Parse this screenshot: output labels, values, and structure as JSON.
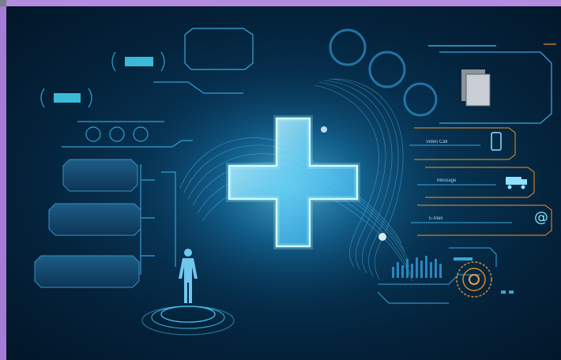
{
  "hud": {
    "contact_items": [
      {
        "label": "Video Call",
        "icon": "phone-icon"
      },
      {
        "label": "Message",
        "icon": "message-truck-icon"
      },
      {
        "label": "E-Mail",
        "icon": "at-sign-icon"
      }
    ]
  },
  "colors": {
    "background_dark": "#021628",
    "background_mid": "#0c4b73",
    "glow_cyan": "#6fe3ff",
    "hud_line": "#2f9fd6",
    "accent_orange": "#d9882a",
    "frame_purple": "#a57bd6"
  },
  "icons": [
    "medical-cross-icon",
    "human-body-icon",
    "sim-card-icon",
    "phone-icon",
    "message-truck-icon",
    "at-sign-icon",
    "gear-dial-icon"
  ]
}
